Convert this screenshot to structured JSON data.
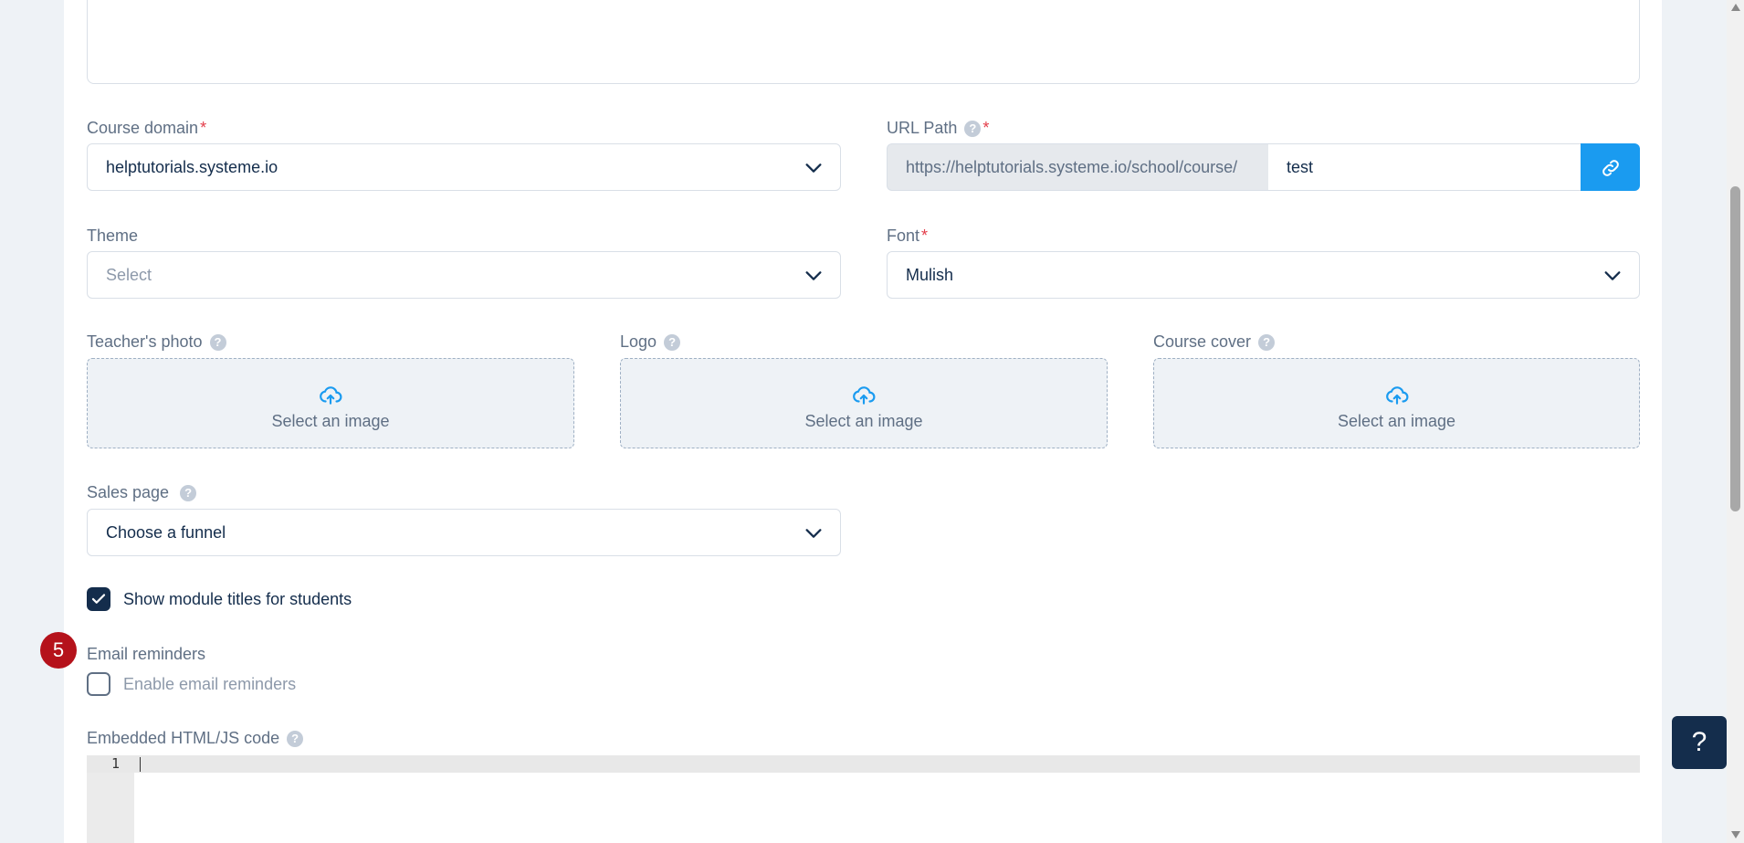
{
  "course_domain": {
    "label": "Course domain",
    "required_mark": "*",
    "value": "helptutorials.systeme.io"
  },
  "url_path": {
    "label": "URL Path",
    "help": "?",
    "required_mark": "*",
    "prefix": "https://helptutorials.systeme.io/school/course/",
    "value": "test",
    "link_icon": "link-icon"
  },
  "theme": {
    "label": "Theme",
    "placeholder": "Select"
  },
  "font": {
    "label": "Font",
    "required_mark": "*",
    "value": "Mulish"
  },
  "uploads": [
    {
      "label": "Teacher's photo",
      "help": "?",
      "text": "Select an image",
      "icon": "cloud-upload-icon"
    },
    {
      "label": "Logo",
      "help": "?",
      "text": "Select an image",
      "icon": "cloud-upload-icon"
    },
    {
      "label": "Course cover",
      "help": "?",
      "text": "Select an image",
      "icon": "cloud-upload-icon"
    }
  ],
  "sales_page": {
    "label": "Sales page",
    "help": "?",
    "value": "Choose a funnel"
  },
  "show_module_titles": {
    "label": "Show module titles for students",
    "checked": true
  },
  "step_badge": "5",
  "email_reminders": {
    "label": "Email reminders",
    "checkbox_label": "Enable email reminders",
    "checked": false
  },
  "embedded_code": {
    "label": "Embedded HTML/JS code",
    "help": "?",
    "line_number": "1"
  },
  "help_widget": {
    "label": "?"
  },
  "colors": {
    "accent": "#1a9bf0",
    "navy": "#142d4c",
    "badge": "#b5121b",
    "required": "#e33d4a"
  }
}
